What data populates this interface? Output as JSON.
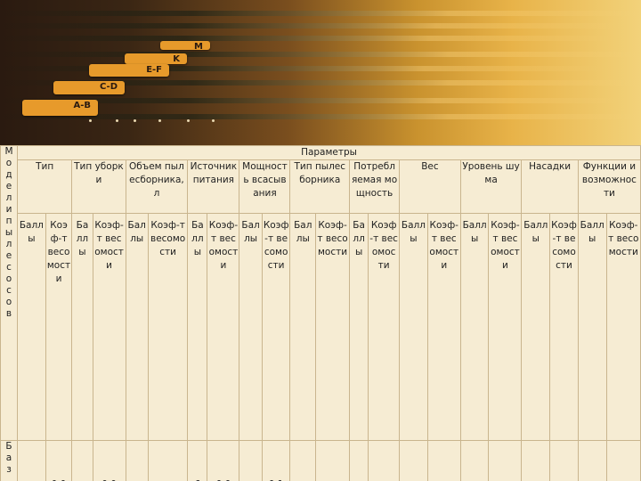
{
  "banner": {
    "tabs": [
      "A-B",
      "C-D",
      "E-F",
      "K",
      "M"
    ]
  },
  "table": {
    "corner_header": "Модели пылесосов",
    "super_header": "Параметры",
    "columns": [
      "Тип",
      "Тип уборки",
      "Объем пылесборника, л",
      "Источник питания",
      "Мощность всасывания",
      "Тип пылесборника",
      "Потребляемая мощность",
      "Вес",
      "Уровень шума",
      "Насадки",
      "Функции и возможности"
    ],
    "subheaders": [
      [
        "Баллы",
        "Коэф-т весомости"
      ],
      [
        "Баллы",
        "Коэф-т весомости"
      ],
      [
        "Баллы",
        "Коэф-т весомости"
      ],
      [
        "Баллы",
        "Коэф-т весомости"
      ],
      [
        "Баллы",
        "Коэф-т весомости"
      ],
      [
        "Баллы",
        "Коэф-т весомости"
      ],
      [
        "Баллы",
        "Коэф-т весомости"
      ],
      [
        "Баллы",
        "Коэф-т весомости"
      ],
      [
        "Баллы",
        "Коэф-т весомости"
      ],
      [
        "Баллы",
        "Коэф-т весомости"
      ],
      [
        "Баллы",
        "Коэф-т весомости"
      ]
    ],
    "first_row": {
      "model": "Баз",
      "values": [
        "",
        "0,0",
        "",
        "0,0",
        "",
        "",
        "6",
        "0,0",
        "",
        "0,1",
        "",
        "",
        "",
        "",
        "",
        "",
        "",
        "",
        "",
        "",
        "",
        ""
      ]
    }
  }
}
